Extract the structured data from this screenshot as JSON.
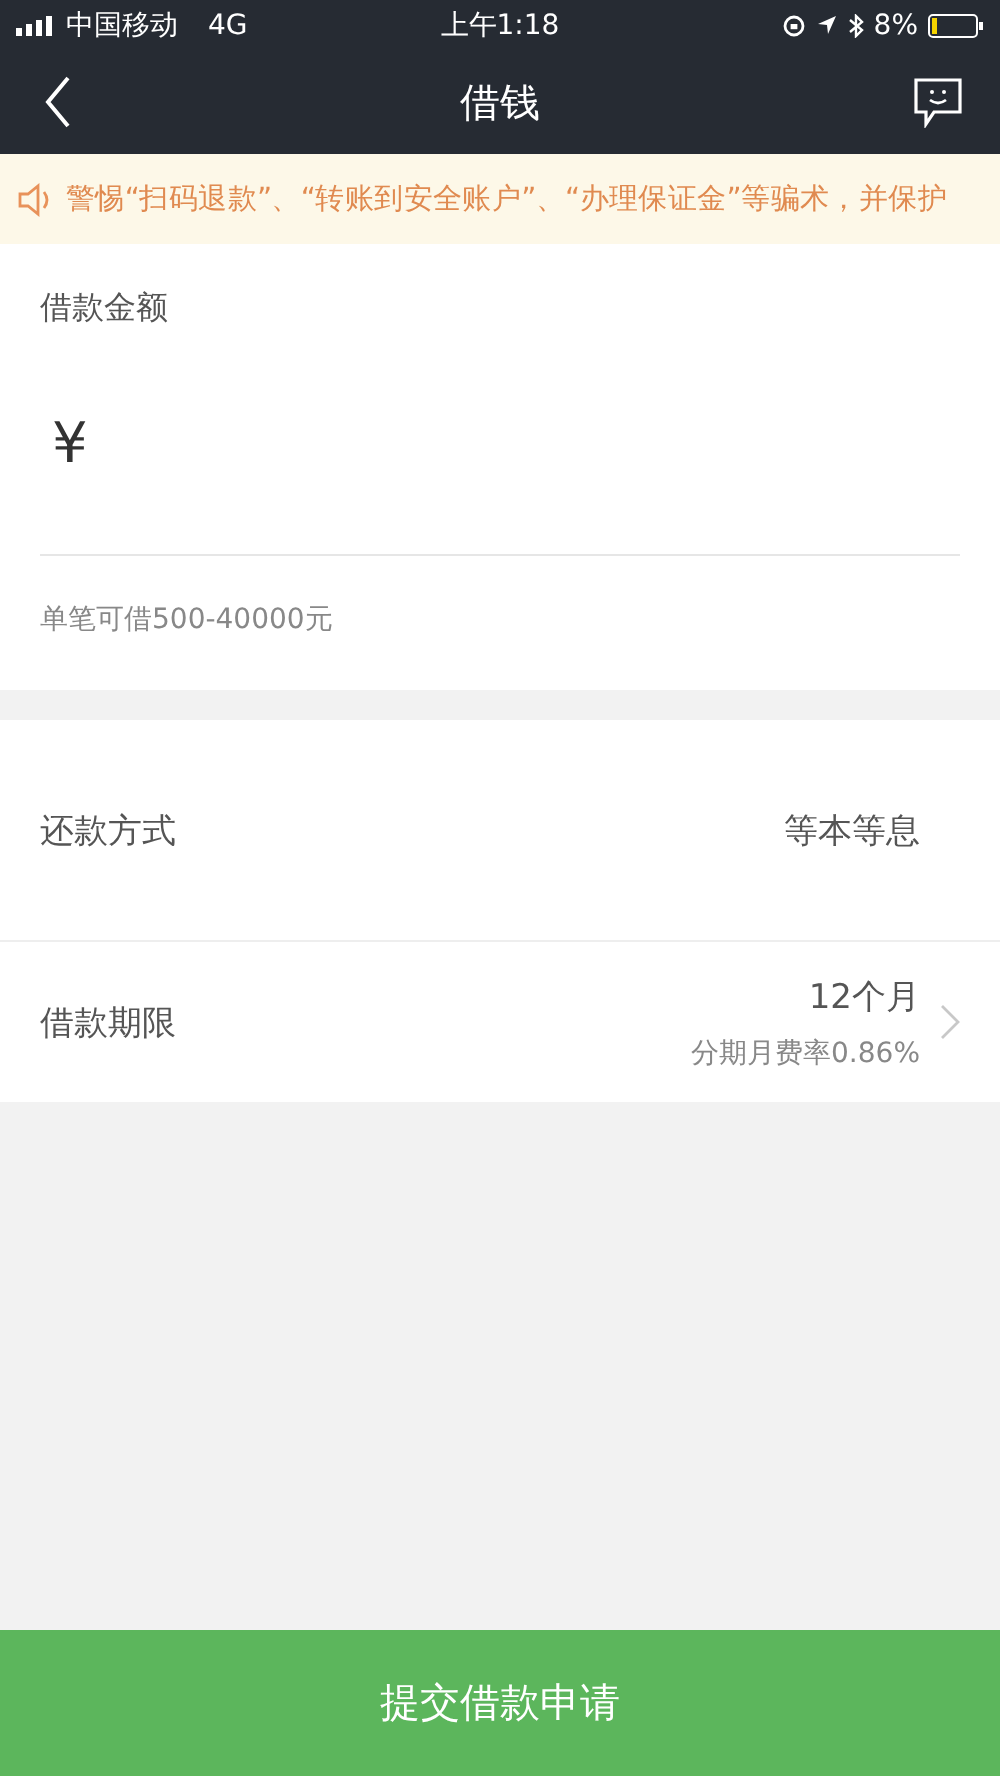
{
  "status_bar": {
    "carrier": "中国移动",
    "network": "4G",
    "time": "上午1:18",
    "battery": "8%"
  },
  "nav": {
    "title": "借钱"
  },
  "notice": {
    "text": "警惕“扫码退款”、“转账到安全账户”、“办理保证金”等骗术，并保护"
  },
  "amount": {
    "label": "借款金额",
    "currency": "¥",
    "hint": "单笔可借500-40000元"
  },
  "options": [
    {
      "label": "还款方式",
      "value": "等本等息",
      "has_arrow": false
    },
    {
      "label": "借款期限",
      "value": "12个月",
      "note": "分期月费率0.86%",
      "has_arrow": true
    }
  ],
  "submit": {
    "label": "提交借款申请"
  }
}
